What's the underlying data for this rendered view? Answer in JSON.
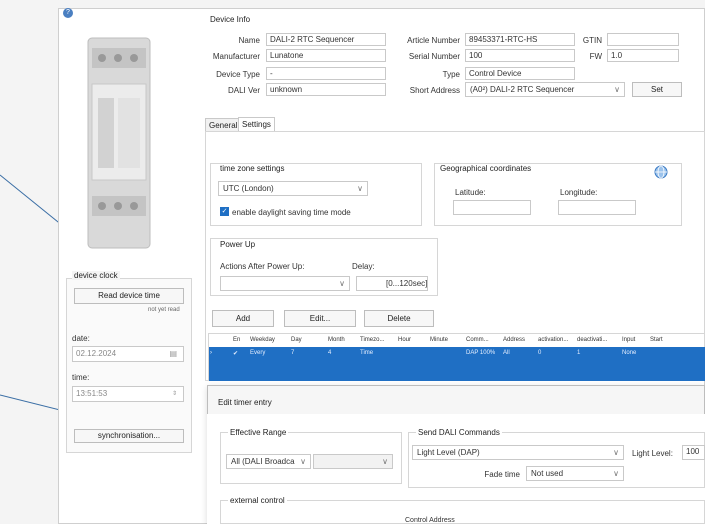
{
  "help_icon": "?",
  "device_info": {
    "title": "Device Info",
    "name_label": "Name",
    "name_value": "DALI-2 RTC Sequencer",
    "manufacturer_label": "Manufacturer",
    "manufacturer_value": "Lunatone",
    "device_type_label": "Device Type",
    "device_type_value": "-",
    "dali_ver_label": "DALI Ver",
    "dali_ver_value": "unknown",
    "article_label": "Article Number",
    "article_value": "89453371-RTC-HS",
    "gtin_label": "GTIN",
    "gtin_value": "",
    "serial_label": "Serial Number",
    "serial_value": "100",
    "fw_label": "FW",
    "fw_value": "1.0",
    "type_label": "Type",
    "type_value": "Control Device",
    "short_address_label": "Short Address",
    "short_address_value": "(A0²) DALI-2 RTC Sequencer",
    "set_button": "Set"
  },
  "tabs": [
    "General",
    "Settings"
  ],
  "timezone": {
    "title": "time zone settings",
    "value": "UTC (London)",
    "dst_label": "enable daylight saving time mode",
    "dst_checked": true
  },
  "geo": {
    "title": "Geographical coordinates",
    "latitude_label": "Latitude:",
    "longitude_label": "Longitude:",
    "globe_icon": "globe-icon"
  },
  "power_up": {
    "title": "Power Up",
    "actions_label": "Actions After Power Up:",
    "delay_label": "Delay:",
    "delay_hint": "[0...120sec]"
  },
  "buttons": {
    "add": "Add",
    "edit": "Edit...",
    "delete": "Delete"
  },
  "table": {
    "headers": [
      "En",
      "Weekday",
      "Day",
      "Month",
      "Timezo...",
      "Hour",
      "Minute",
      "Comm...",
      "Address",
      "activation...",
      "deactivati...",
      "Input",
      "Start"
    ],
    "row": [
      "✔",
      "Every",
      "7",
      "4",
      "Time",
      "",
      "",
      "DAP 100%",
      "All",
      "0",
      "1",
      "None",
      ""
    ]
  },
  "device_clock": {
    "title": "device clock",
    "read_button": "Read device time",
    "not_read": "not yet read",
    "date_label": "date:",
    "date_value": "02.12.2024",
    "time_label": "time:",
    "time_value": "13:51:53",
    "sync_button": "synchronisation..."
  },
  "dialog": {
    "title": "Edit timer entry",
    "effective_range_title": "Effective Range",
    "effective_range_value": "All (DALI Broadca",
    "send_dali_title": "Send DALI Commands",
    "command_value": "Light Level (DAP)",
    "light_level_label": "Light Level:",
    "light_level_value": "100",
    "fade_time_label": "Fade time",
    "fade_time_value": "Not used",
    "external_control_title": "external control",
    "control_address_label": "Control Address"
  },
  "colors": {
    "accent": "#1f6fc4",
    "callout": "#3a6ea5",
    "selection": "#1f6fc4"
  }
}
